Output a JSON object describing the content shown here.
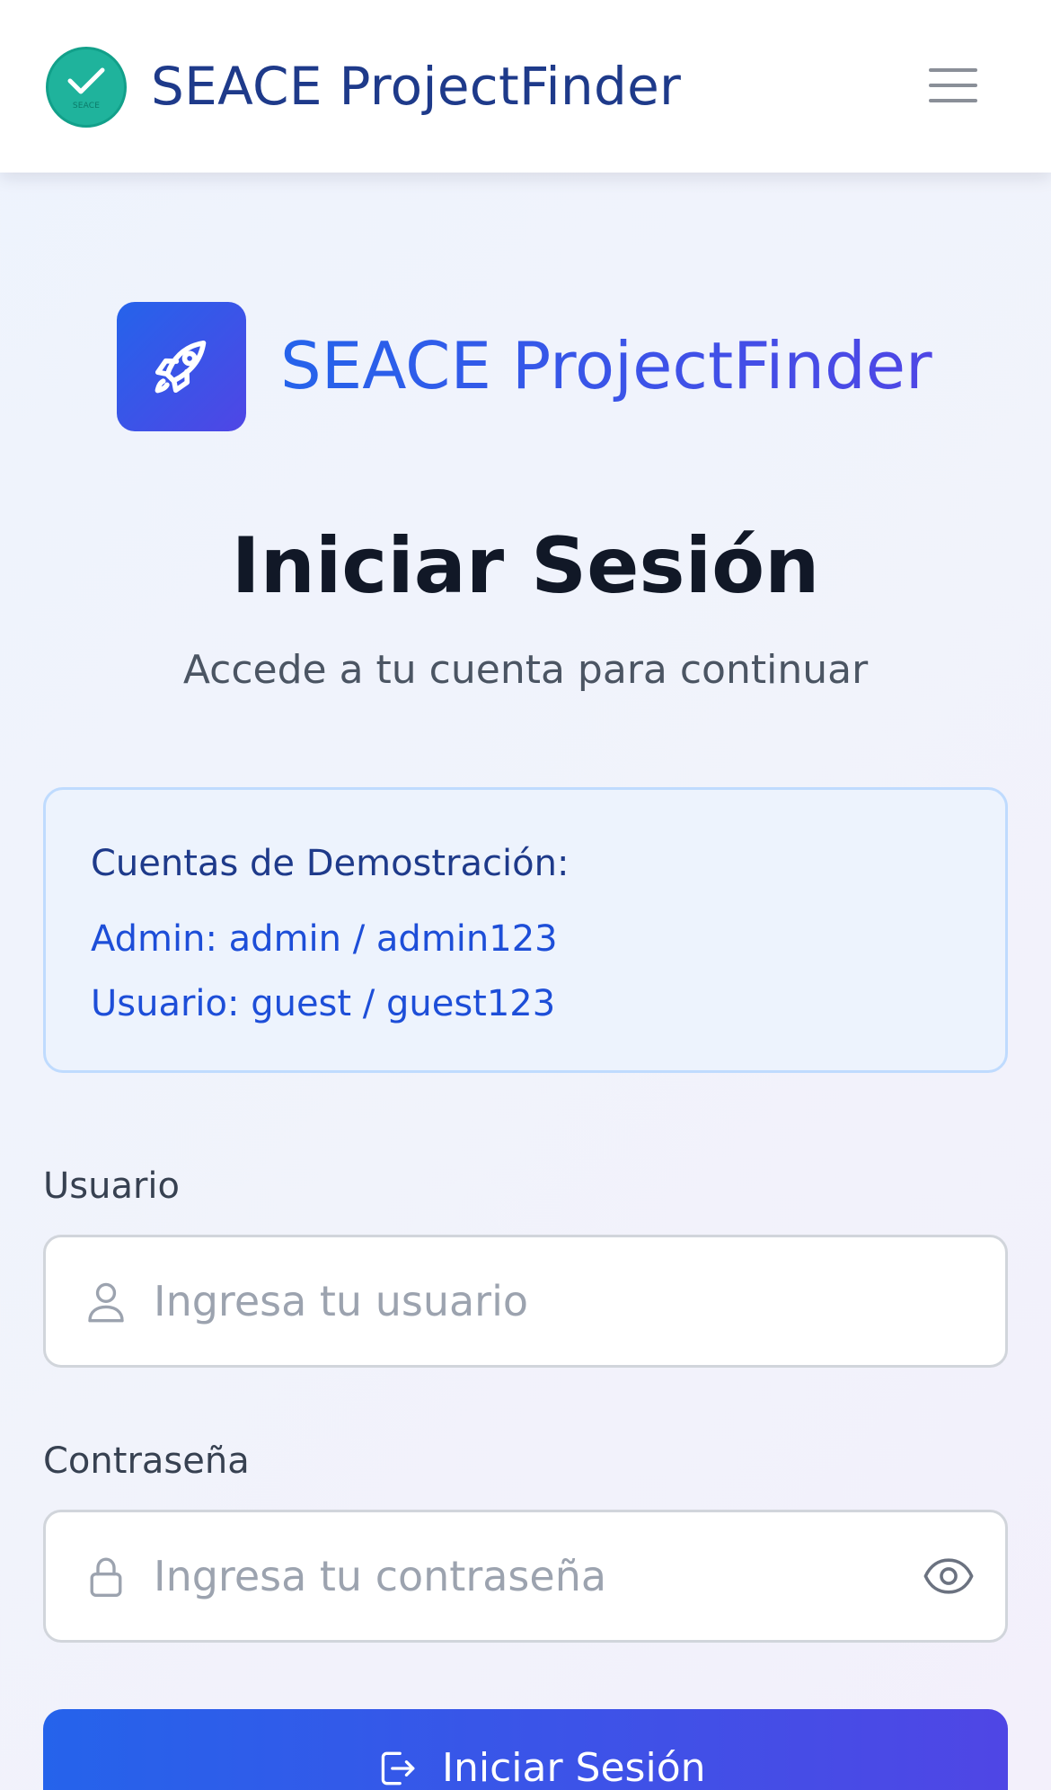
{
  "navbar": {
    "app_title": "SEACE ProjectFinder",
    "logo_seal_text": "SEACE",
    "menu_icon": "hamburger-menu-icon",
    "logo_color": "#1fb39c"
  },
  "brand": {
    "icon": "rocket-icon",
    "name": "SEACE ProjectFinder"
  },
  "login": {
    "title": "Iniciar Sesión",
    "subtitle": "Accede a tu cuenta para continuar"
  },
  "demo_accounts": {
    "title": "Cuentas de Demostración:",
    "lines": [
      "Admin: admin / admin123",
      "Usuario: guest / guest123"
    ]
  },
  "form": {
    "username": {
      "label": "Usuario",
      "placeholder": "Ingresa tu usuario",
      "value": "",
      "icon": "user-icon"
    },
    "password": {
      "label": "Contraseña",
      "placeholder": "Ingresa tu contraseña",
      "value": "",
      "icon": "lock-icon",
      "toggle_icon": "eye-icon"
    },
    "submit": {
      "label": "Iniciar Sesión",
      "icon": "login-icon"
    }
  },
  "colors": {
    "primary_start": "#2563eb",
    "primary_end": "#4f46e5",
    "info_border": "#bfdbfe",
    "info_bg": "#edf3fd"
  }
}
